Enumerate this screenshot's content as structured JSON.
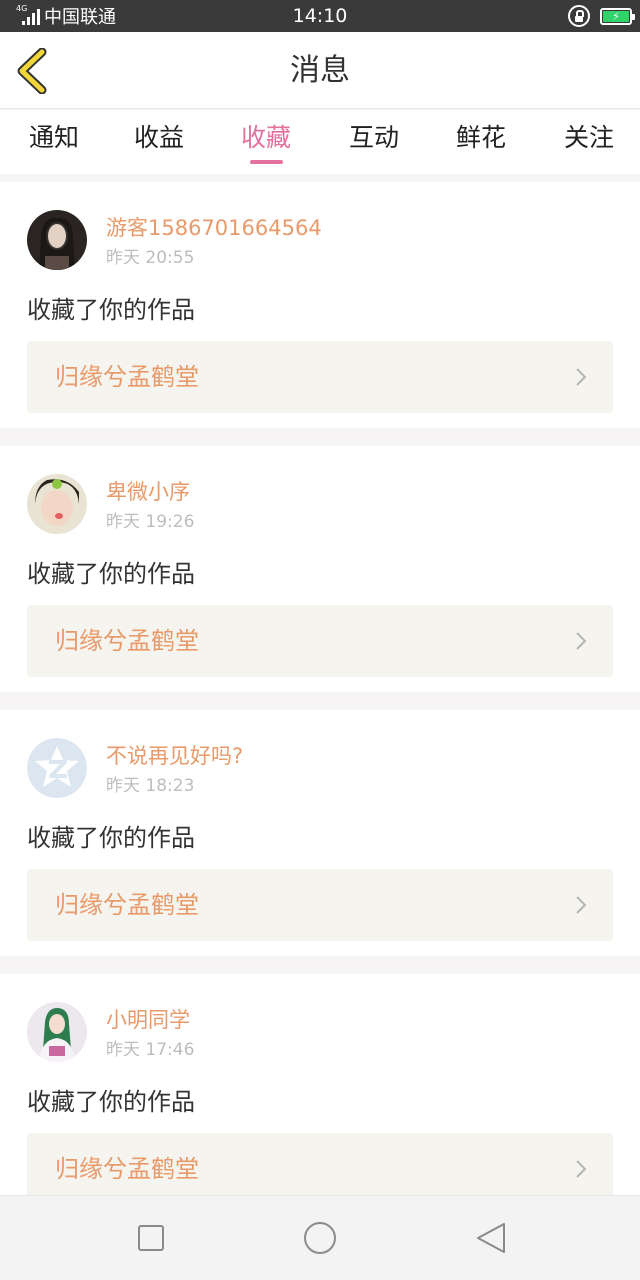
{
  "status_bar": {
    "network_type": "4G",
    "carrier": "中国联通",
    "time": "14:10",
    "battery_color": "#2fd36a"
  },
  "header": {
    "title": "消息",
    "back_icon": "chevron-left-icon",
    "accent_color": "#f2d63a"
  },
  "tabs": [
    {
      "label": "通知",
      "active": false
    },
    {
      "label": "收益",
      "active": false
    },
    {
      "label": "收藏",
      "active": true
    },
    {
      "label": "互动",
      "active": false
    },
    {
      "label": "鲜花",
      "active": false
    },
    {
      "label": "关注",
      "active": false
    }
  ],
  "active_tab_color": "#e4709d",
  "messages": [
    {
      "username": "游客1586701664564",
      "time": "昨天 20:55",
      "action": "收藏了你的作品",
      "work_title": "归缘兮孟鹤堂",
      "avatar_icon": "avatar-photo"
    },
    {
      "username": "卑微小序",
      "time": "昨天 19:26",
      "action": "收藏了你的作品",
      "work_title": "归缘兮孟鹤堂",
      "avatar_icon": "avatar-photo"
    },
    {
      "username": "不说再见好吗?",
      "time": "昨天 18:23",
      "action": "收藏了你的作品",
      "work_title": "归缘兮孟鹤堂",
      "avatar_icon": "qzone-star-icon"
    },
    {
      "username": "小明同学",
      "time": "昨天 17:46",
      "action": "收藏了你的作品",
      "work_title": "归缘兮孟鹤堂",
      "avatar_icon": "avatar-photo"
    }
  ],
  "username_color": "#e89a6a",
  "nav_bar": {
    "icons": [
      "square-recents-icon",
      "circle-home-icon",
      "triangle-back-icon"
    ]
  }
}
